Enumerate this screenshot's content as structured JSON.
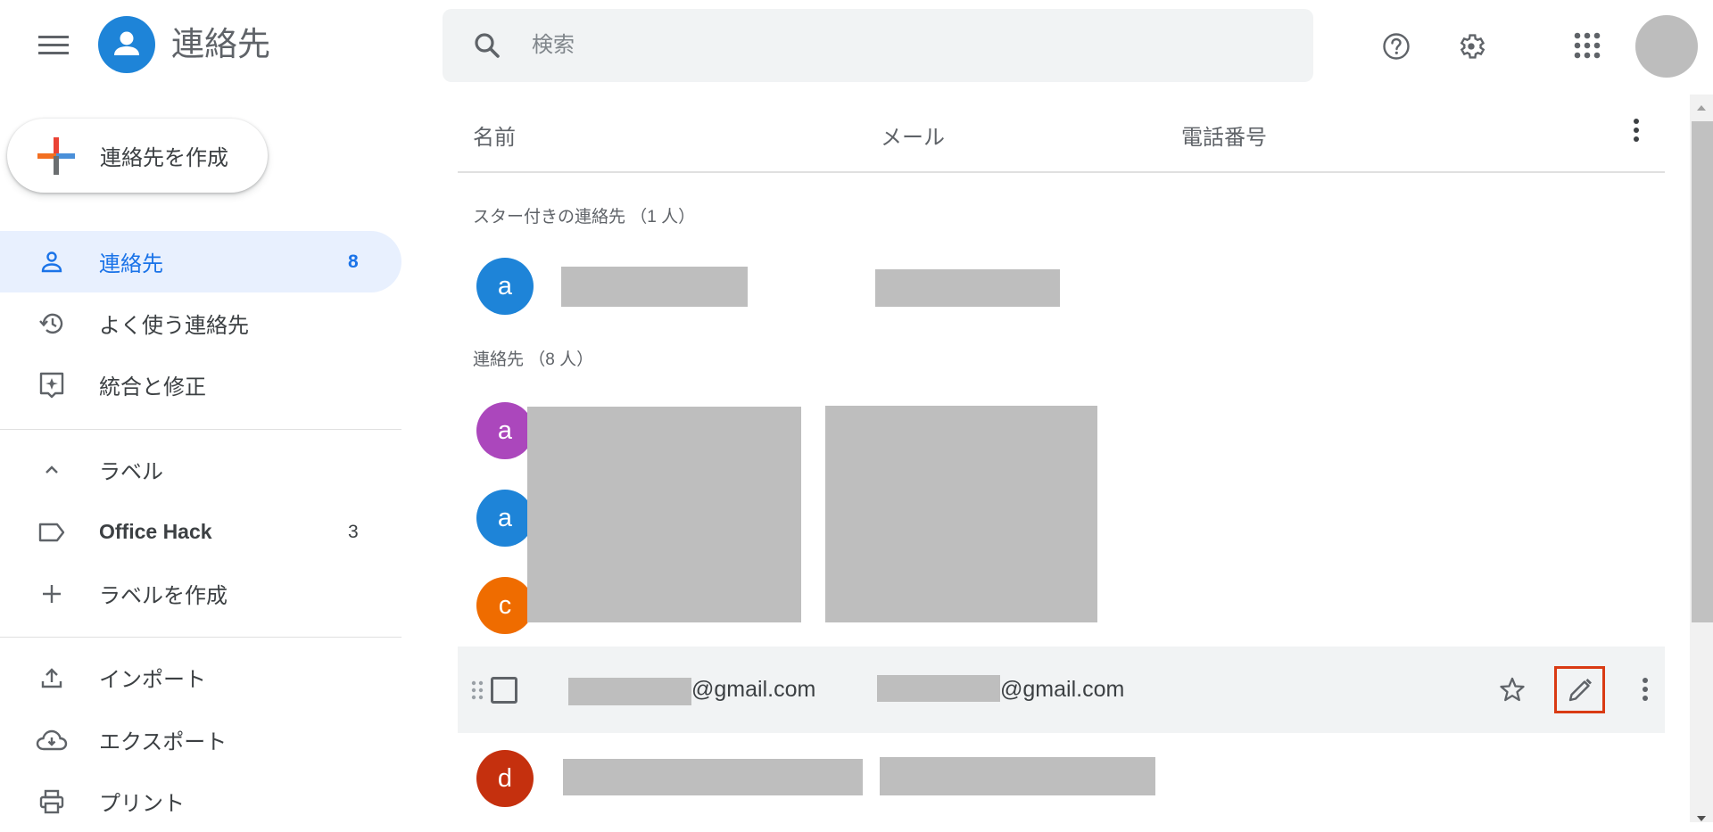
{
  "header": {
    "menu_icon": "hamburger-menu-icon",
    "app_icon": "contacts-person-icon",
    "app_title": "連絡先",
    "search_placeholder": "検索",
    "search_value": "",
    "help_icon": "help-circle-icon",
    "settings_icon": "gear-icon",
    "apps_icon": "apps-grid-icon",
    "avatar_icon": "account-avatar"
  },
  "sidebar": {
    "create_label": "連絡先を作成",
    "items": [
      {
        "label": "連絡先",
        "count": "8",
        "icon": "person-outline-icon",
        "active": true
      },
      {
        "label": "よく使う連絡先",
        "count": "",
        "icon": "history-icon"
      },
      {
        "label": "統合と修正",
        "count": "",
        "icon": "merge-fix-icon"
      }
    ],
    "labels_header": {
      "label": "ラベル",
      "icon": "chevron-up-icon"
    },
    "labels": [
      {
        "label": "Office Hack",
        "count": "3",
        "icon": "label-outline-icon"
      }
    ],
    "create_label_item": {
      "label": "ラベルを作成",
      "icon": "plus-icon"
    },
    "actions": [
      {
        "label": "インポート",
        "icon": "upload-icon"
      },
      {
        "label": "エクスポート",
        "icon": "cloud-download-icon"
      },
      {
        "label": "プリント",
        "icon": "printer-icon"
      }
    ]
  },
  "main": {
    "columns": {
      "name": "名前",
      "email": "メール",
      "phone": "電話番号"
    },
    "starred_section": "スター付きの連絡先 （1 人）",
    "contacts_section": "連絡先 （8 人）",
    "starred": [
      {
        "initial": "a",
        "color": "#1e84d8"
      }
    ],
    "contacts": [
      {
        "initial": "a",
        "color": "#ab47bc"
      },
      {
        "initial": "a",
        "color": "#1e84d8"
      },
      {
        "initial": "c",
        "color": "#ef6c00"
      },
      {
        "initial": "",
        "color": "",
        "name_suffix": "@gmail.com",
        "email_suffix": "@gmail.com",
        "hovered": true
      },
      {
        "initial": "d",
        "color": "#c5300e"
      }
    ],
    "row_actions": {
      "star_icon": "star-outline-icon",
      "edit_icon": "pencil-edit-icon",
      "more_icon": "more-vert-icon"
    },
    "highlight_color": "#d93a13"
  }
}
